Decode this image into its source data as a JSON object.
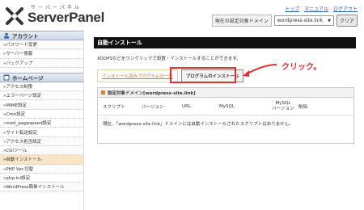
{
  "header": {
    "brand_sub": "サーバーパネル",
    "brand": "ServerPanel",
    "links": [
      "トップ",
      "マニュアル",
      "ログアウト"
    ],
    "domain_label": "現在の設定対象ドメイン",
    "domain_value": "wordpress-site.link",
    "clear_label": "クリア"
  },
  "sidebar": {
    "sections": [
      {
        "title": "アカウント",
        "items": [
          "パスワード変更",
          "サーバー情報",
          "バックアップ"
        ]
      },
      {
        "title": "ホームページ",
        "items": [
          "アクセス制限",
          "エラーページ設定",
          "MIME設定",
          "Cron設定",
          "mod_pagespeed設定",
          "サイト転送設定",
          "アクセス拒否設定",
          "CGIツール",
          "自動インストール",
          "PHP Ver.切替",
          "php.ini設定",
          "WordPress簡単インストール"
        ]
      }
    ],
    "active_item": "自動インストール"
  },
  "main": {
    "title": "自動インストール",
    "description": "XOOPSなどをワンクリックで設置・インストールすることができます。",
    "tabs": [
      "インストール済みプログラムの一覧",
      "プログラムのインストール"
    ],
    "annotation": "クリック。",
    "panel_title": "設定対象ドメイン[wordpress-site.link]",
    "columns": [
      "スクリプト",
      "バージョン",
      "URL",
      "MySQL",
      "MySQL\nバージョン",
      "削除"
    ],
    "empty_message": "現在、「wordpress-site.link」ドメインには自動インストールされたスクリプトはありません。"
  },
  "colors": {
    "active_bg": "#f9e4c7",
    "title_bar": "#111111",
    "highlight": "#e03030",
    "link": "#3355aa"
  }
}
